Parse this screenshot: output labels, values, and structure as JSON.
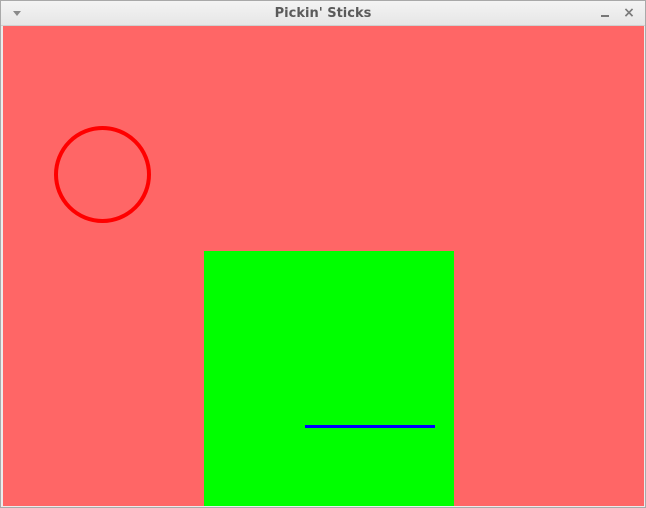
{
  "window": {
    "title": "Pickin' Sticks",
    "close_glyph": "×"
  },
  "icons": {
    "menu": "window-menu-icon",
    "minimize": "minimize-icon",
    "close": "close-icon"
  },
  "colors": {
    "background": "#ff6666",
    "ring": "#ff0000",
    "square": "#00ff00",
    "stick": "#0000ff"
  }
}
